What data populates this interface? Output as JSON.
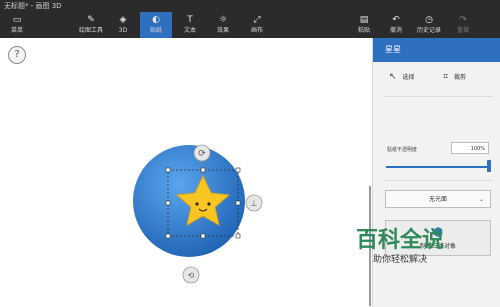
{
  "window": {
    "title": "无标题* - 画图 3D"
  },
  "toolbar": {
    "menu": {
      "label": "菜单",
      "icon": "folder-icon"
    },
    "brushes": {
      "label": "绘图工具",
      "icon": "brush-icon"
    },
    "shapes3d": {
      "label": "3D",
      "icon": "cube-icon"
    },
    "stickers": {
      "label": "贴纸",
      "icon": "sticker-icon"
    },
    "text": {
      "label": "文本",
      "icon": "text-icon"
    },
    "effects": {
      "label": "效果",
      "icon": "sun-icon"
    },
    "canvas": {
      "label": "画布",
      "icon": "resize-icon"
    },
    "paste": {
      "label": "粘贴",
      "icon": "clipboard-icon"
    },
    "undo": {
      "label": "撤消",
      "icon": "undo-icon"
    },
    "history": {
      "label": "历史记录",
      "icon": "history-icon"
    },
    "redo": {
      "label": "重做",
      "icon": "redo-icon"
    }
  },
  "help": {
    "label": "?"
  },
  "panel": {
    "title": "星星",
    "select_label": "选择",
    "crop_label": "裁剪",
    "opacity_label": "贴纸不透明度",
    "opacity_value": "100%",
    "opacity_fraction": 1.0,
    "finish_value": "无光面",
    "make3d_label": "制作三维对象"
  },
  "watermark": {
    "main": "百科全说",
    "sub": "助你轻松解决"
  },
  "colors": {
    "accent": "#2f6fc0",
    "toolbar_bg": "#2b2b2b",
    "sphere": "#3b86d6",
    "star": "#f7c623"
  }
}
